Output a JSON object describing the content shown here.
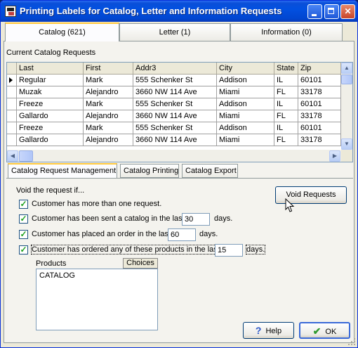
{
  "window": {
    "title": "Printing Labels for Catalog, Letter and Information Requests",
    "controls": {
      "minimize": "",
      "maximize": "",
      "close": "✕"
    }
  },
  "tabs": [
    {
      "label": "Catalog (621)",
      "active": true
    },
    {
      "label": "Letter (1)",
      "active": false
    },
    {
      "label": "Information (0)",
      "active": false
    }
  ],
  "catalog": {
    "section_label": "Current Catalog Requests",
    "columns": [
      "",
      "Last",
      "First",
      "Addr3",
      "City",
      "State",
      "Zip"
    ],
    "rows": [
      [
        "Regular",
        "Mark",
        "555 Schenker St",
        "Addison",
        "IL",
        "60101"
      ],
      [
        "Muzak",
        "Alejandro",
        "3660 NW 114 Ave",
        "Miami",
        "FL",
        "33178"
      ],
      [
        "Freeze",
        "Mark",
        "555 Schenker St",
        "Addison",
        "IL",
        "60101"
      ],
      [
        "Gallardo",
        "Alejandro",
        "3660 NW 114 Ave",
        "Miami",
        "FL",
        "33178"
      ],
      [
        "Freeze",
        "Mark",
        "555 Schenker St",
        "Addison",
        "IL",
        "60101"
      ],
      [
        "Gallardo",
        "Alejandro",
        "3660 NW 114 Ave",
        "Miami",
        "FL",
        "33178"
      ]
    ]
  },
  "subtabs": [
    {
      "label": "Catalog Request Management",
      "active": true
    },
    {
      "label": "Catalog Printing",
      "active": false
    },
    {
      "label": "Catalog Export",
      "active": false
    }
  ],
  "management": {
    "void_label": "Void the request if...",
    "void_button": "Void Requests",
    "options": [
      {
        "label": "Customer has more than one request.",
        "checked": true
      },
      {
        "label": "Customer has been sent a catalog in the last",
        "checked": true,
        "value": "30",
        "suffix": "days."
      },
      {
        "label": "Customer has placed an order in the last",
        "checked": true,
        "value": "60",
        "suffix": "days."
      },
      {
        "label": "Customer has ordered any of these products in the last",
        "checked": true,
        "value": "15",
        "suffix": "days."
      }
    ],
    "products_label": "Products",
    "choices_button": "Choices",
    "products": [
      "CATALOG"
    ]
  },
  "footer": {
    "help_label": "Help",
    "ok_label": "OK"
  },
  "colors": {
    "titlebar": "#0250e0",
    "active_tab_accent": "#ffc83c",
    "check": "#21a121"
  }
}
